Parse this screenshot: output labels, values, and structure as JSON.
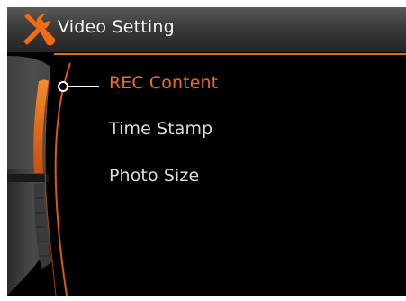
{
  "header": {
    "title": "Video Setting",
    "icon": "tools-icon"
  },
  "menu": {
    "items": [
      {
        "label": "REC Content",
        "selected": true
      },
      {
        "label": "Time Stamp",
        "selected": false
      },
      {
        "label": "Photo Size",
        "selected": false
      }
    ]
  },
  "colors": {
    "accent": "#ea6a1a",
    "text": "#dcdcdc",
    "background": "#000000",
    "header": "#3a3a3a"
  }
}
